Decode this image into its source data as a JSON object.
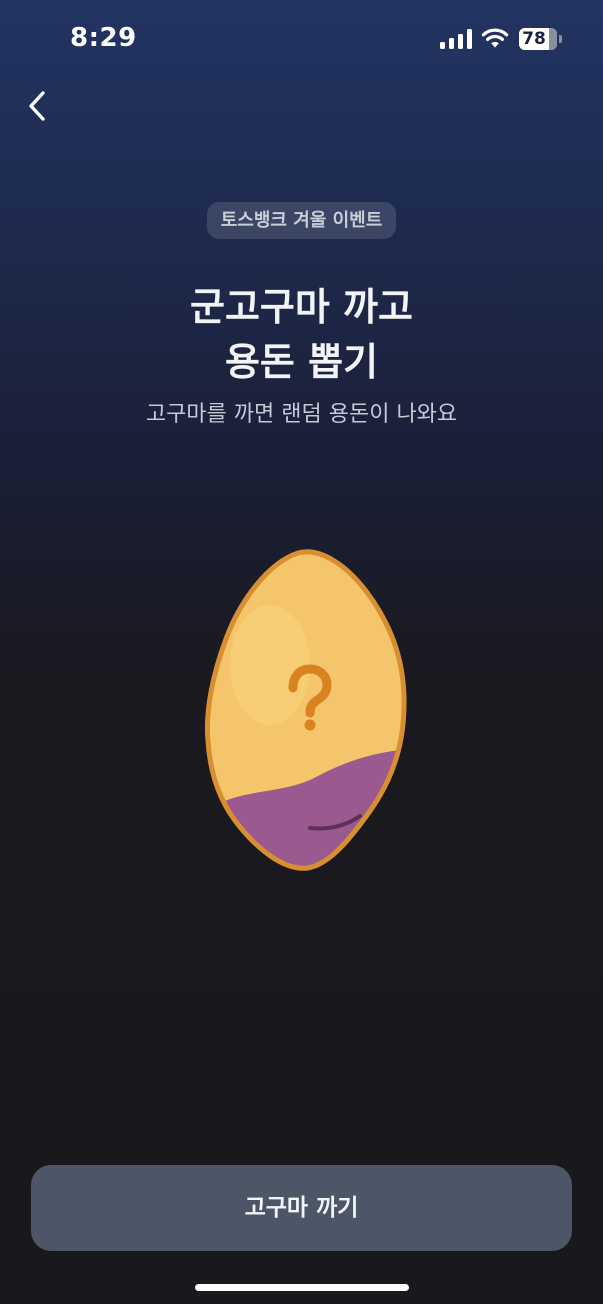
{
  "status_bar": {
    "time": "8:29",
    "battery_level": "78",
    "battery_percent": 78
  },
  "header": {
    "back_icon": "chevron-left-icon"
  },
  "event": {
    "badge": "토스뱅크 겨울 이벤트",
    "title_line1": "군고구마 까고",
    "title_line2": "용돈 뽑기",
    "subtitle": "고구마를 까면 랜덤 용돈이 나와요"
  },
  "illustration": {
    "icon": "sweet-potato-question-icon",
    "question_mark": "?",
    "colors": {
      "flesh": "#f5c56b",
      "outline": "#d98f2f",
      "skin": "#9a5a8f",
      "question": "#d9821f"
    }
  },
  "actions": {
    "peel_button_label": "고구마 까기"
  },
  "colors": {
    "background_top": "#223463",
    "background_bottom": "#19181c",
    "button": "#4c5666"
  }
}
